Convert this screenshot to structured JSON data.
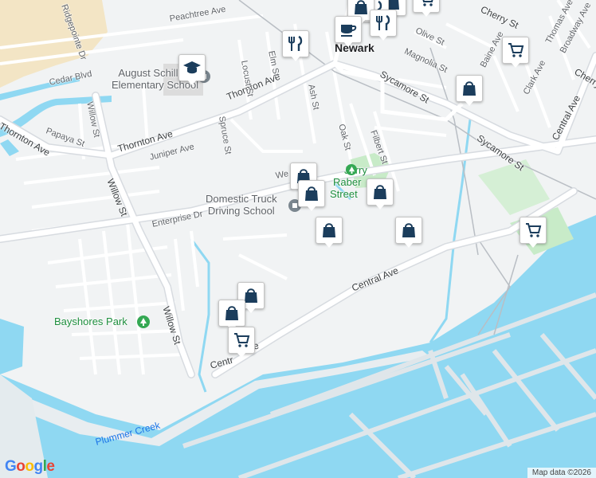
{
  "map": {
    "colors": {
      "land": "#f1f3f4",
      "water": "#8fd8f2",
      "sand": "#f3e5c5",
      "park": "#c8ebc8",
      "road": "#ffffff",
      "road_edge": "#d7dbe0",
      "marker": "#1b3d5c"
    },
    "streets": [
      {
        "id": "peachtree",
        "text": "Peachtree Ave"
      },
      {
        "id": "ridgepointe",
        "text": "Ridgepointe Dr"
      },
      {
        "id": "cedar",
        "text": "Cedar Blvd"
      },
      {
        "id": "willow-top",
        "text": "Willow St"
      },
      {
        "id": "willow-mid",
        "text": "Willow St"
      },
      {
        "id": "willow-low",
        "text": "Willow St"
      },
      {
        "id": "thornton-w",
        "text": "Thornton Ave"
      },
      {
        "id": "thornton-e",
        "text": "Thornton Ave"
      },
      {
        "id": "papaya",
        "text": "Papaya St"
      },
      {
        "id": "juniper",
        "text": "Juniper Ave"
      },
      {
        "id": "spruce",
        "text": "Spruce St"
      },
      {
        "id": "locust",
        "text": "Locust St"
      },
      {
        "id": "elm",
        "text": "Elm St"
      },
      {
        "id": "ash",
        "text": "Ash St"
      },
      {
        "id": "oak",
        "text": "Oak St"
      },
      {
        "id": "filbert",
        "text": "Filbert St"
      },
      {
        "id": "sycamore-w",
        "text": "Sycamore St"
      },
      {
        "id": "sycamore-e",
        "text": "Sycamore St"
      },
      {
        "id": "magnolia",
        "text": "Magnolia St"
      },
      {
        "id": "olive",
        "text": "Olive St"
      },
      {
        "id": "cherry",
        "text": "Cherry St"
      },
      {
        "id": "cherry-e",
        "text": "Cherry"
      },
      {
        "id": "thomas",
        "text": "Thomas Ave"
      },
      {
        "id": "broadway",
        "text": "Broadway Ave"
      },
      {
        "id": "baine",
        "text": "Baine Ave"
      },
      {
        "id": "clark",
        "text": "Clark Ave"
      },
      {
        "id": "central-ne",
        "text": "Central Ave"
      },
      {
        "id": "central-mid",
        "text": "Central Ave"
      },
      {
        "id": "central-sw",
        "text": "Centr"
      },
      {
        "id": "central-sw2",
        "text": "e"
      },
      {
        "id": "enterprise",
        "text": "Enterprise Dr"
      },
      {
        "id": "we",
        "text": "We"
      }
    ],
    "pois": {
      "school": [
        "August Schilling",
        "Elementary School"
      ],
      "truck": [
        "Domestic Truck",
        "Driving School"
      ],
      "park_street": [
        "Jerry",
        "Raber",
        "Street"
      ],
      "bayshores": "Bayshores Park",
      "city": "Newark",
      "creek": "Plummer Creek"
    },
    "markers": [
      {
        "id": "m-food-1",
        "icon": "restaurant-icon"
      },
      {
        "id": "m-food-2",
        "icon": "restaurant-icon"
      },
      {
        "id": "m-cafe",
        "icon": "cafe-icon"
      },
      {
        "id": "m-store-top",
        "icon": "shopping-cart-icon"
      },
      {
        "id": "m-cart-baine",
        "icon": "shopping-cart-icon"
      },
      {
        "id": "m-bag-sycamore",
        "icon": "shopping-bag-icon"
      },
      {
        "id": "m-school",
        "icon": "graduation-cap-icon"
      },
      {
        "id": "m-bag-1",
        "icon": "shopping-bag-icon"
      },
      {
        "id": "m-bag-2",
        "icon": "shopping-bag-icon"
      },
      {
        "id": "m-bag-3",
        "icon": "shopping-bag-icon"
      },
      {
        "id": "m-bag-4",
        "icon": "shopping-bag-icon"
      },
      {
        "id": "m-bag-5",
        "icon": "shopping-bag-icon"
      },
      {
        "id": "m-cart-east",
        "icon": "shopping-cart-icon"
      },
      {
        "id": "m-bag-6",
        "icon": "shopping-bag-icon"
      },
      {
        "id": "m-bag-7",
        "icon": "shopping-bag-icon"
      },
      {
        "id": "m-cart-central",
        "icon": "shopping-cart-icon"
      }
    ],
    "logo": "Google",
    "attribution": "Map data ©2026"
  }
}
